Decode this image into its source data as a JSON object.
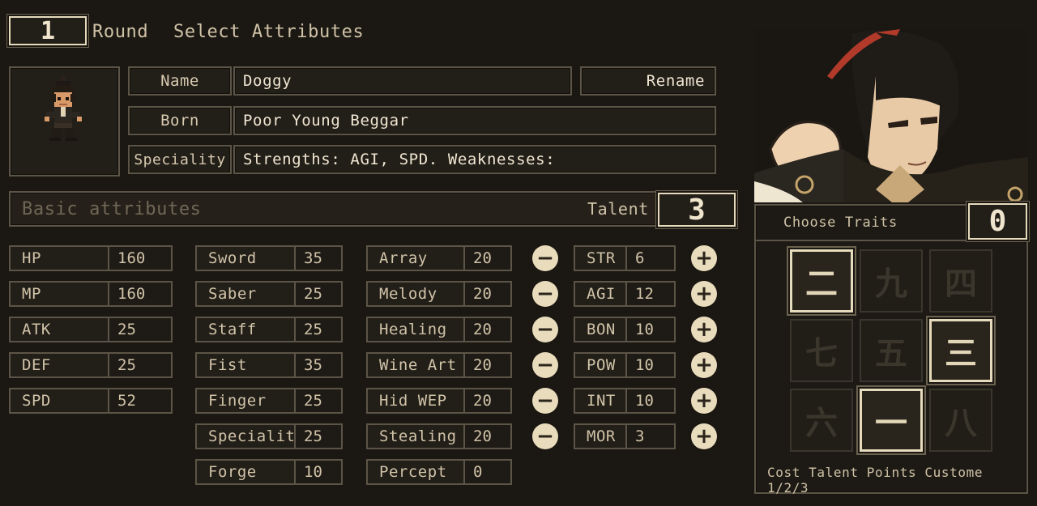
{
  "header": {
    "round_number": "1",
    "round_label": "Round",
    "step_label": "Select Attributes"
  },
  "profile": {
    "name_label": "Name",
    "name_value": "Doggy",
    "rename_label": "Rename",
    "born_label": "Born",
    "born_value": "Poor Young Beggar",
    "speciality_label": "Speciality",
    "speciality_value": "Strengths: AGI, SPD. Weaknesses:"
  },
  "basic": {
    "title": "Basic attributes",
    "talent_label": "Talent",
    "talent_value": "3"
  },
  "core_stats": [
    {
      "name": "HP",
      "value": "160"
    },
    {
      "name": "MP",
      "value": "160"
    },
    {
      "name": "ATK",
      "value": "25"
    },
    {
      "name": "DEF",
      "value": "25"
    },
    {
      "name": "SPD",
      "value": "52"
    }
  ],
  "weapon_skills": [
    {
      "name": "Sword",
      "value": "35"
    },
    {
      "name": "Saber",
      "value": "25"
    },
    {
      "name": "Staff",
      "value": "25"
    },
    {
      "name": "Fist",
      "value": "35"
    },
    {
      "name": "Finger",
      "value": "25"
    },
    {
      "name": "Specialit",
      "value": "25"
    },
    {
      "name": "Forge",
      "value": "10"
    }
  ],
  "arts_skills": [
    {
      "name": "Array",
      "value": "20"
    },
    {
      "name": "Melody",
      "value": "20"
    },
    {
      "name": "Healing",
      "value": "20"
    },
    {
      "name": "Wine Art",
      "value": "20"
    },
    {
      "name": "Hid WEP",
      "value": "20"
    },
    {
      "name": "Stealing",
      "value": "20"
    },
    {
      "name": "Percept",
      "value": "0"
    }
  ],
  "attributes": [
    {
      "name": "STR",
      "value": "6"
    },
    {
      "name": "AGI",
      "value": "12"
    },
    {
      "name": "BON",
      "value": "10"
    },
    {
      "name": "POW",
      "value": "10"
    },
    {
      "name": "INT",
      "value": "10"
    },
    {
      "name": "MOR",
      "value": "3"
    }
  ],
  "minus_symbol": "−",
  "plus_symbol": "+",
  "traits": {
    "title": "Choose Traits",
    "count": "0",
    "grid": [
      {
        "glyph": "二",
        "selected": true
      },
      {
        "glyph": "九",
        "selected": false
      },
      {
        "glyph": "四",
        "selected": false
      },
      {
        "glyph": "七",
        "selected": false
      },
      {
        "glyph": "五",
        "selected": false
      },
      {
        "glyph": "三",
        "selected": true
      },
      {
        "glyph": "六",
        "selected": false
      },
      {
        "glyph": "一",
        "selected": true
      },
      {
        "glyph": "八",
        "selected": false
      }
    ],
    "footer": "Cost Talent Points Custome 1/2/3"
  },
  "colors": {
    "background": "#1b1813",
    "frame": "#5c5446",
    "accent_cream": "#e7dbbd",
    "text": "#d9ccb2"
  }
}
